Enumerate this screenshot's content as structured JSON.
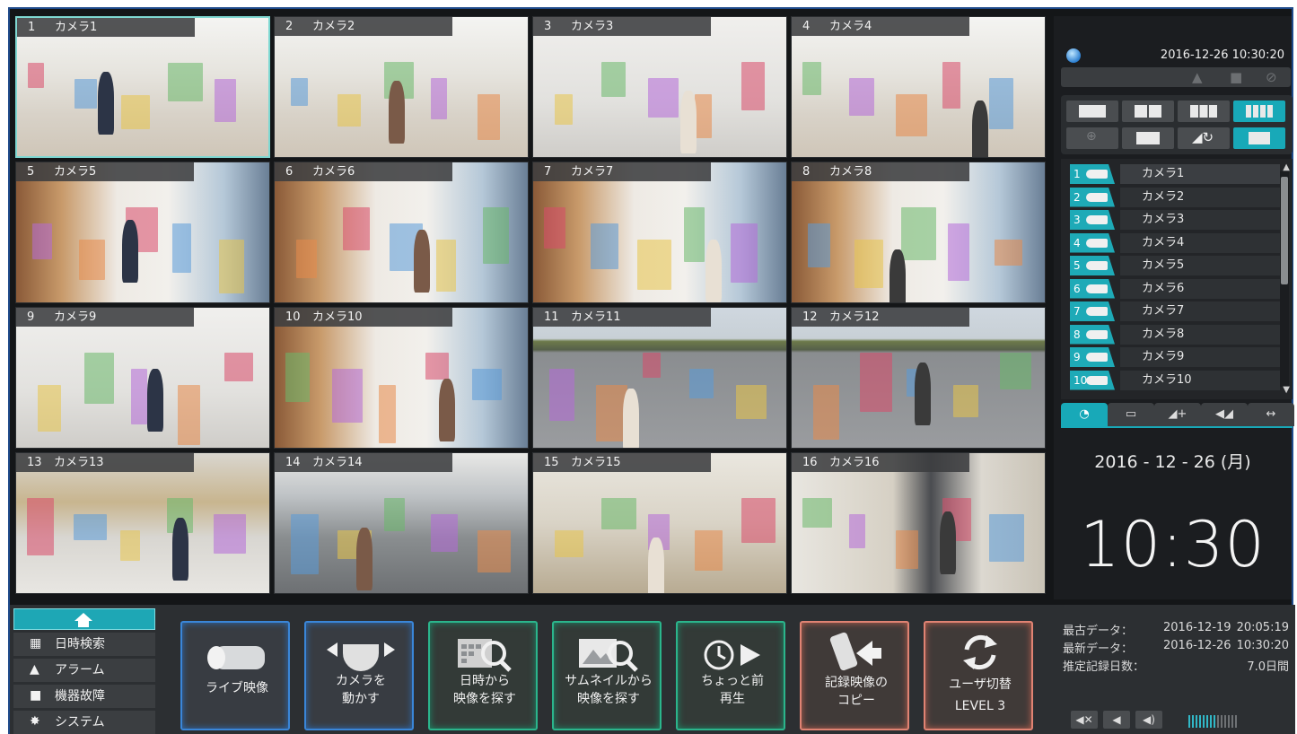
{
  "cameras": [
    {
      "num": "1",
      "name": "カメラ1"
    },
    {
      "num": "2",
      "name": "カメラ2"
    },
    {
      "num": "3",
      "name": "カメラ3"
    },
    {
      "num": "4",
      "name": "カメラ4"
    },
    {
      "num": "5",
      "name": "カメラ5"
    },
    {
      "num": "6",
      "name": "カメラ6"
    },
    {
      "num": "7",
      "name": "カメラ7"
    },
    {
      "num": "8",
      "name": "カメラ8"
    },
    {
      "num": "9",
      "name": "カメラ9"
    },
    {
      "num": "10",
      "name": "カメラ10"
    },
    {
      "num": "11",
      "name": "カメラ11"
    },
    {
      "num": "12",
      "name": "カメラ12"
    },
    {
      "num": "13",
      "name": "カメラ13"
    },
    {
      "num": "14",
      "name": "カメラ14"
    },
    {
      "num": "15",
      "name": "カメラ15"
    },
    {
      "num": "16",
      "name": "カメラ16"
    }
  ],
  "header": {
    "datetime": "2016-12-26   10:30:20"
  },
  "camera_list": [
    {
      "num": "1",
      "name": "カメラ1"
    },
    {
      "num": "2",
      "name": "カメラ2"
    },
    {
      "num": "3",
      "name": "カメラ3"
    },
    {
      "num": "4",
      "name": "カメラ4"
    },
    {
      "num": "5",
      "name": "カメラ5"
    },
    {
      "num": "6",
      "name": "カメラ6"
    },
    {
      "num": "7",
      "name": "カメラ7"
    },
    {
      "num": "8",
      "name": "カメラ8"
    },
    {
      "num": "9",
      "name": "カメラ9"
    },
    {
      "num": "10",
      "name": "カメラ10"
    }
  ],
  "clock": {
    "date": "2016 - 12 - 26  (月)",
    "time": "10:30"
  },
  "menu": {
    "items": [
      "日時検索",
      "アラーム",
      "機器故障",
      "システム"
    ]
  },
  "buttons": {
    "live": "ライブ映像",
    "move_camera_1": "カメラを",
    "move_camera_2": "動かす",
    "search_date_1": "日時から",
    "search_date_2": "映像を探す",
    "search_thumb_1": "サムネイルから",
    "search_thumb_2": "映像を探す",
    "replay_1": "ちょっと前",
    "replay_2": "再生",
    "copy_1": "記録映像の",
    "copy_2": "コピー",
    "user_1": "ユーザ切替",
    "user_2": "LEVEL 3"
  },
  "info": {
    "oldest_label": "最古データ：",
    "oldest_date": "2016-12-19",
    "oldest_time": "20:05:19",
    "newest_label": "最新データ：",
    "newest_date": "2016-12-26",
    "newest_time": "10:30:20",
    "days_label": "推定記録日数：",
    "days_value": "7.0日間"
  },
  "volume": {
    "level": 0.55
  },
  "colors": {
    "accent": "#18a9b8",
    "blue": "#3a86d8",
    "green": "#2bb58c",
    "red": "#e08373"
  }
}
